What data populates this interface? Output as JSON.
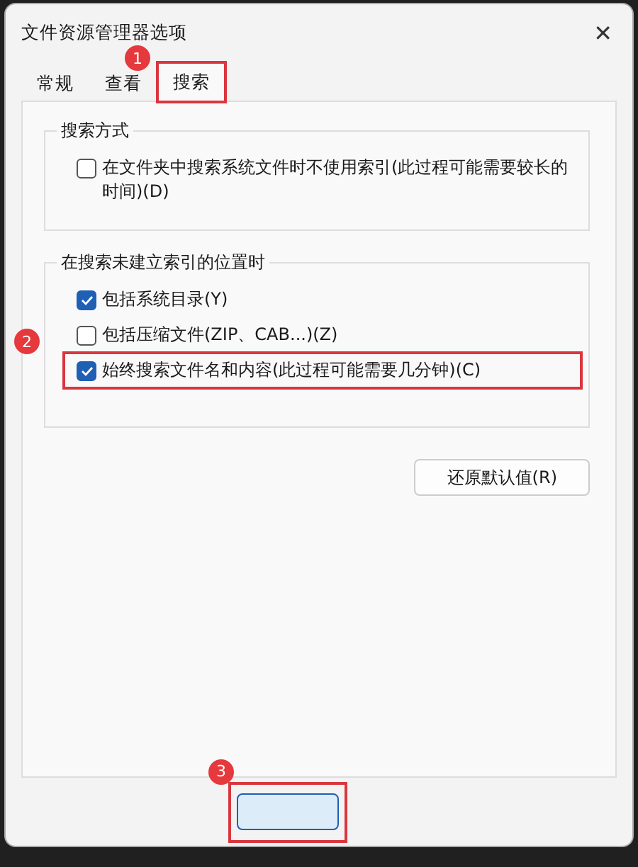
{
  "window": {
    "title": "文件资源管理器选项",
    "close": "✕"
  },
  "tabs": [
    {
      "label": "常规",
      "selected": false,
      "highlighted": false
    },
    {
      "label": "查看",
      "selected": false,
      "highlighted": false
    },
    {
      "label": "搜索",
      "selected": true,
      "highlighted": true,
      "callout": "1"
    }
  ],
  "groups": [
    {
      "title": "搜索方式",
      "options": [
        {
          "label": "在文件夹中搜索系统文件时不使用索引(此过程可能需要较长的时间)(D)",
          "checked": false,
          "highlighted": false
        }
      ]
    },
    {
      "title": "在搜索未建立索引的位置时",
      "options": [
        {
          "label": "包括系统目录(Y)",
          "checked": true,
          "highlighted": false
        },
        {
          "label": "包括压缩文件(ZIP、CAB...)(Z)",
          "checked": false,
          "highlighted": false,
          "callout": "2"
        },
        {
          "label": "始终搜索文件名和内容(此过程可能需要几分钟)(C)",
          "checked": true,
          "highlighted": true
        }
      ]
    }
  ],
  "restore_button": "还原默认值(R)",
  "dialog_buttons": [
    {
      "kind": "default",
      "highlighted": true,
      "callout": "3"
    }
  ]
}
